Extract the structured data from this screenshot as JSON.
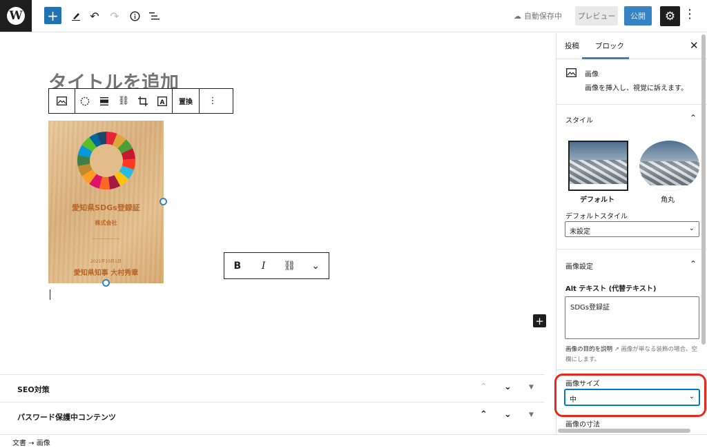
{
  "topbar": {
    "autosave_text": "自動保存中",
    "preview_label": "プレビュー",
    "publish_label": "公開",
    "icons": [
      "wordpress-logo",
      "add-block",
      "edit-pencil",
      "undo",
      "redo",
      "info",
      "list-view",
      "cloud",
      "gear",
      "more-vertical"
    ]
  },
  "editor": {
    "title_placeholder": "タイトルを追加",
    "block_toolbar": {
      "replace_label": "置換"
    },
    "image": {
      "cert_title": "愛知県SDGs登録証",
      "cert_company": "株式会社",
      "cert_date": "2021年10月1日",
      "cert_sign": "愛知県知事 大村秀章"
    },
    "format_toolbar": {
      "bold": "B",
      "italic": "I"
    }
  },
  "metaboxes": [
    {
      "title": "SEO対策"
    },
    {
      "title": "パスワード保護中コンテンツ"
    }
  ],
  "statusbar": {
    "breadcrumb": "文書 → 画像"
  },
  "sidebar": {
    "tabs": [
      "投稿",
      "ブロック"
    ],
    "active_tab": "ブロック",
    "block_card": {
      "title": "画像",
      "description": "画像を挿入し、視覚に訴えます。"
    },
    "styles": {
      "heading": "スタイル",
      "options": [
        "デフォルト",
        "角丸"
      ],
      "selected": "デフォルト",
      "default_style_label": "デフォルトスタイル",
      "default_style_value": "未設定"
    },
    "image_settings": {
      "heading": "画像設定",
      "alt_label": "Alt テキスト (代替テキスト)",
      "alt_value": "SDGs登録証",
      "help_prefix": "画像の目的を説明",
      "help_suffix": "画像が単なる装飾の場合、空欄にします。",
      "size_label": "画像サイズ",
      "size_value": "中",
      "dimensions_label": "画像の寸法"
    }
  },
  "colors": {
    "accent": "#3582c4",
    "highlight": "#e8261c",
    "dark": "#1e1e1e"
  }
}
